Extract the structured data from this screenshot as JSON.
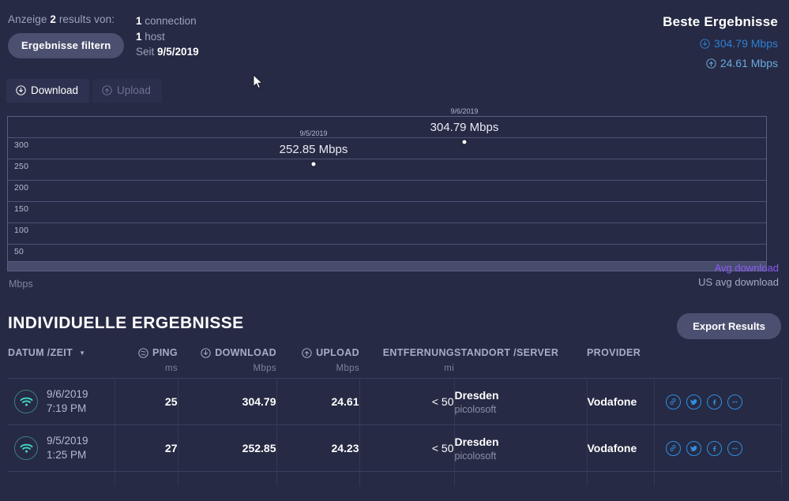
{
  "summary": {
    "showing_prefix": "Anzeige",
    "showing_count": "2",
    "showing_suffix": "results von:",
    "filter_button": "Ergebnisse filtern",
    "connections_count": "1",
    "connections_label": "connection",
    "hosts_count": "1",
    "hosts_label": "host",
    "since_label": "Seit",
    "since_date": "9/5/2019"
  },
  "best_results": {
    "title": "Beste Ergebnisse",
    "download": "304.79 Mbps",
    "upload": "24.61 Mbps",
    "download_icon": "download-circle-icon",
    "upload_icon": "upload-circle-icon",
    "download_color": "#2f7fd4",
    "upload_color": "#6aa9dd"
  },
  "tabs": [
    {
      "label": "Download",
      "icon": "download-circle-icon",
      "active": true
    },
    {
      "label": "Upload",
      "icon": "upload-circle-icon",
      "active": false
    }
  ],
  "chart_data": {
    "type": "line",
    "title": "",
    "xlabel": "",
    "ylabel": "Mbps",
    "ylim": [
      0,
      350
    ],
    "yticks": [
      50,
      100,
      150,
      200,
      250,
      300
    ],
    "grid": true,
    "legend_position": "bottom-right",
    "series": [
      {
        "name": "Avg download",
        "color": "#8b5cf6",
        "x": [
          "9/5/2019",
          "9/6/2019"
        ],
        "values": [
          252.85,
          304.79
        ],
        "point_labels": [
          "252.85 Mbps",
          "304.79 Mbps"
        ]
      },
      {
        "name": "US avg download",
        "color": "#a6aac0",
        "x": [],
        "values": []
      }
    ],
    "legend": [
      "Avg download",
      "US avg download"
    ],
    "axis_unit": "Mbps"
  },
  "results_section": {
    "title": "INDIVIDUELLE ERGEBNISSE",
    "export_button": "Export Results"
  },
  "table": {
    "headers": [
      {
        "label": "DATUM /ZEIT",
        "unit": "",
        "icon": "",
        "sort": true,
        "align": "left"
      },
      {
        "label": "PING",
        "unit": "ms",
        "icon": "ping-circle-icon",
        "align": "right"
      },
      {
        "label": "DOWNLOAD",
        "unit": "Mbps",
        "icon": "download-circle-icon",
        "align": "right"
      },
      {
        "label": "UPLOAD",
        "unit": "Mbps",
        "icon": "upload-circle-icon",
        "align": "right"
      },
      {
        "label": "ENTFERNUNG",
        "unit": "mi",
        "icon": "",
        "align": "right"
      },
      {
        "label": "STANDORT /SERVER",
        "unit": "",
        "icon": "",
        "align": "left"
      },
      {
        "label": "PROVIDER",
        "unit": "",
        "icon": "",
        "align": "left"
      },
      {
        "label": "",
        "unit": "",
        "icon": "",
        "align": "left"
      }
    ],
    "rows": [
      {
        "connection_icon": "wifi-icon",
        "date": "9/6/2019",
        "time": "7:19 PM",
        "ping": "25",
        "download": "304.79",
        "upload": "24.61",
        "distance": "< 50",
        "location": "Dresden",
        "server": "picolosoft",
        "provider": "Vodafone",
        "actions": [
          "link-icon",
          "twitter-icon",
          "facebook-icon",
          "more-icon"
        ]
      },
      {
        "connection_icon": "wifi-icon",
        "date": "9/5/2019",
        "time": "1:25 PM",
        "ping": "27",
        "download": "252.85",
        "upload": "24.23",
        "distance": "< 50",
        "location": "Dresden",
        "server": "picolosoft",
        "provider": "Vodafone",
        "actions": [
          "link-icon",
          "twitter-icon",
          "facebook-icon",
          "more-icon"
        ]
      }
    ]
  }
}
